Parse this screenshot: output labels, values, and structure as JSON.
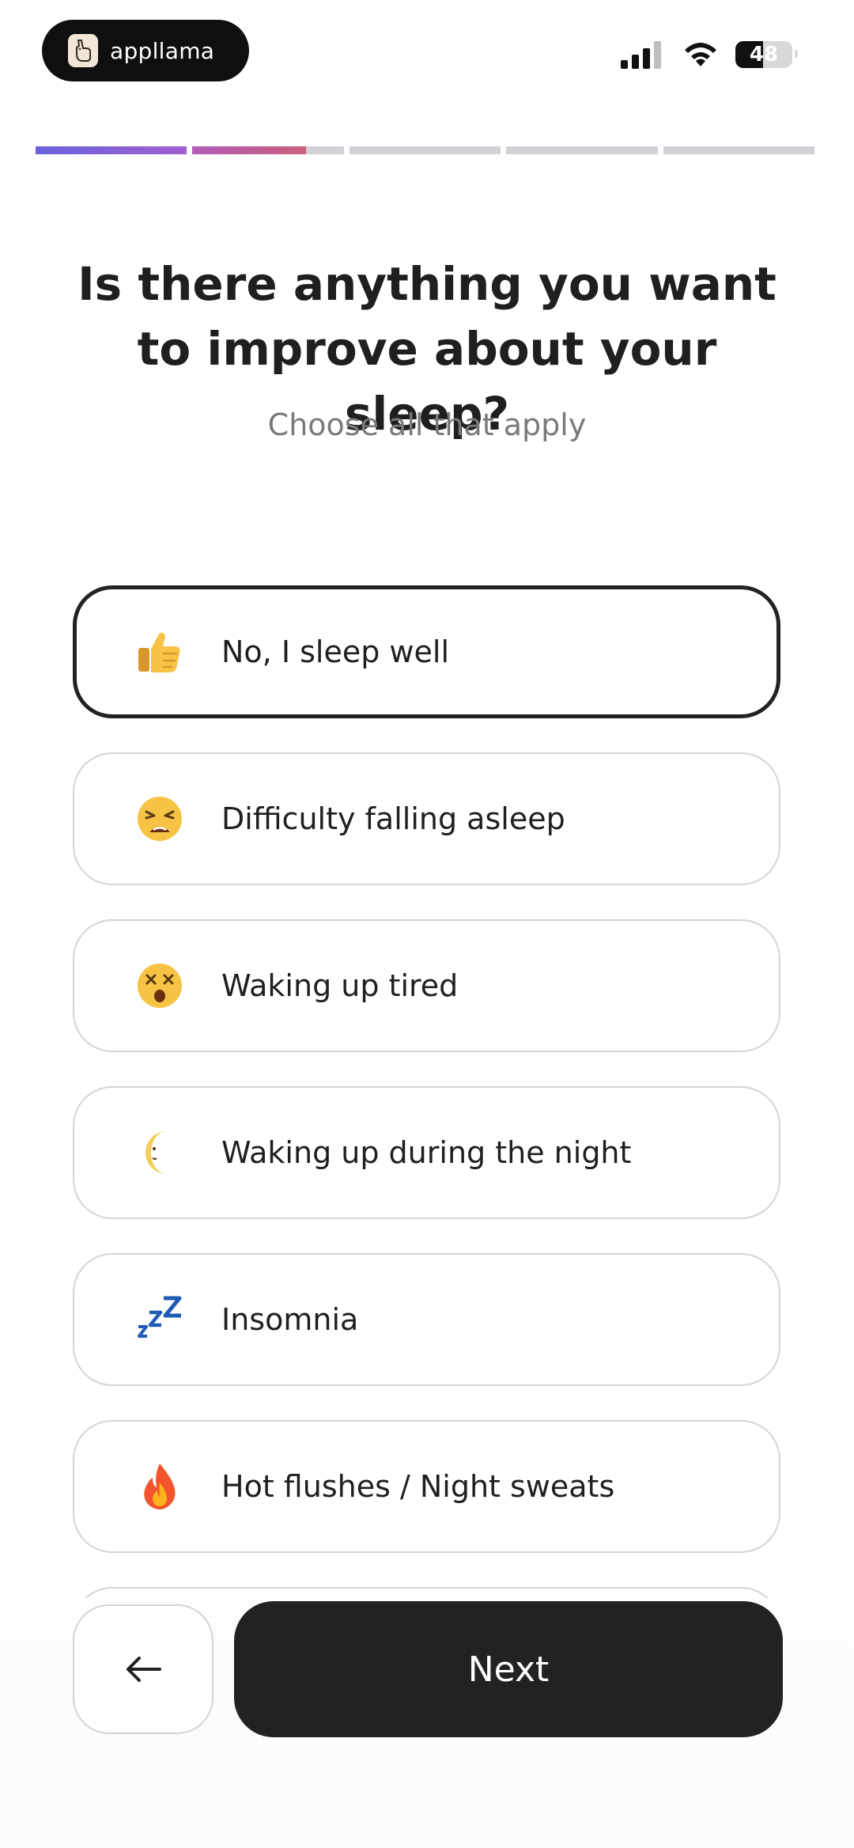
{
  "status_bar": {
    "app_badge": "appllama",
    "battery": "48",
    "battery_level": 0.48
  },
  "progress": {
    "segments": 5,
    "current_step": 2,
    "current_step_fill": 0.75,
    "colors": {
      "step1": "#6a63dd",
      "step2": "#c9607c",
      "track": "#d2d2d6"
    }
  },
  "question": {
    "title_line1": "Is there anything you want",
    "title_line2": "to improve about your sleep?",
    "subtitle": "Choose all that apply"
  },
  "options": [
    {
      "label": "No, I sleep well",
      "icon": "thumbs-up-icon",
      "selected": true
    },
    {
      "label": "Difficulty falling asleep",
      "icon": "weary-face-icon",
      "selected": false
    },
    {
      "label": "Waking up tired",
      "icon": "dizzy-face-icon",
      "selected": false
    },
    {
      "label": "Waking up during the night",
      "icon": "crescent-moon-icon",
      "selected": false
    },
    {
      "label": "Insomnia",
      "icon": "zzz-icon",
      "selected": false
    },
    {
      "label": "Hot flushes / Night sweats",
      "icon": "fire-icon",
      "selected": false
    }
  ],
  "footer": {
    "back_icon": "arrow-left-icon",
    "next_label": "Next"
  }
}
